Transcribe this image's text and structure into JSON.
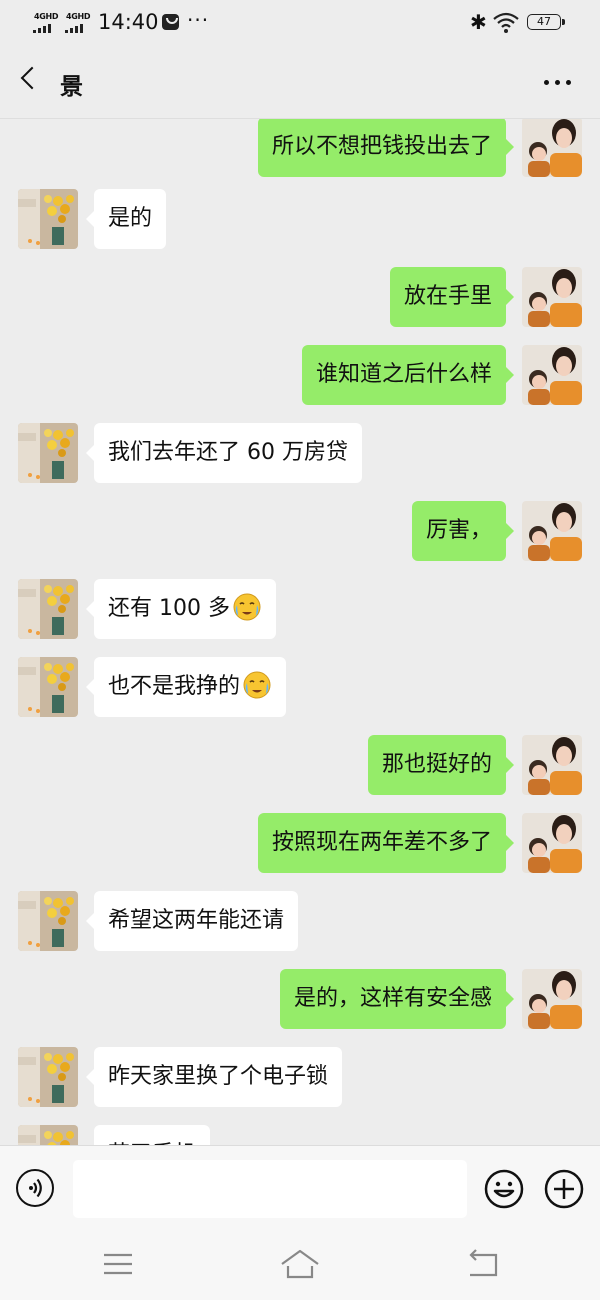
{
  "status_bar": {
    "signal_1": "4GHD",
    "signal_2": "4GHD",
    "time": "14:40",
    "dots": "···",
    "battery": "47",
    "icons": [
      "message-icon",
      "bluetooth-icon",
      "wifi-icon",
      "battery-icon"
    ]
  },
  "header": {
    "title": "景",
    "back_icon": "chevron-left-icon",
    "more_icon": "more-dots-icon"
  },
  "messages": [
    {
      "side": "out",
      "text": "所以不想把钱投出去了"
    },
    {
      "side": "in",
      "text": "是的"
    },
    {
      "side": "out",
      "text": "放在手里"
    },
    {
      "side": "out",
      "text": "谁知道之后什么样"
    },
    {
      "side": "in",
      "text": "我们去年还了 60 万房贷"
    },
    {
      "side": "out",
      "text": "厉害，"
    },
    {
      "side": "in",
      "text": "还有 100 多",
      "emoji": "crying-face"
    },
    {
      "side": "in",
      "text": "也不是我挣的",
      "emoji": "crying-face"
    },
    {
      "side": "out",
      "text": "那也挺好的"
    },
    {
      "side": "out",
      "text": "按照现在两年差不多了"
    },
    {
      "side": "in",
      "text": "希望这两年能还请"
    },
    {
      "side": "out",
      "text": "是的，这样有安全感"
    },
    {
      "side": "in",
      "text": "昨天家里换了个电子锁"
    },
    {
      "side": "in",
      "text": "花了手机"
    }
  ],
  "input": {
    "value": "",
    "voice_icon": "voice-icon",
    "emoji_icon": "smiley-icon",
    "plus_icon": "plus-circle-icon"
  },
  "nav": {
    "menu_icon": "menu-icon",
    "home_icon": "home-icon",
    "back_icon": "back-arrow-icon"
  },
  "colors": {
    "background": "#ededed",
    "outgoing_bubble": "#95ec69",
    "incoming_bubble": "#ffffff"
  }
}
